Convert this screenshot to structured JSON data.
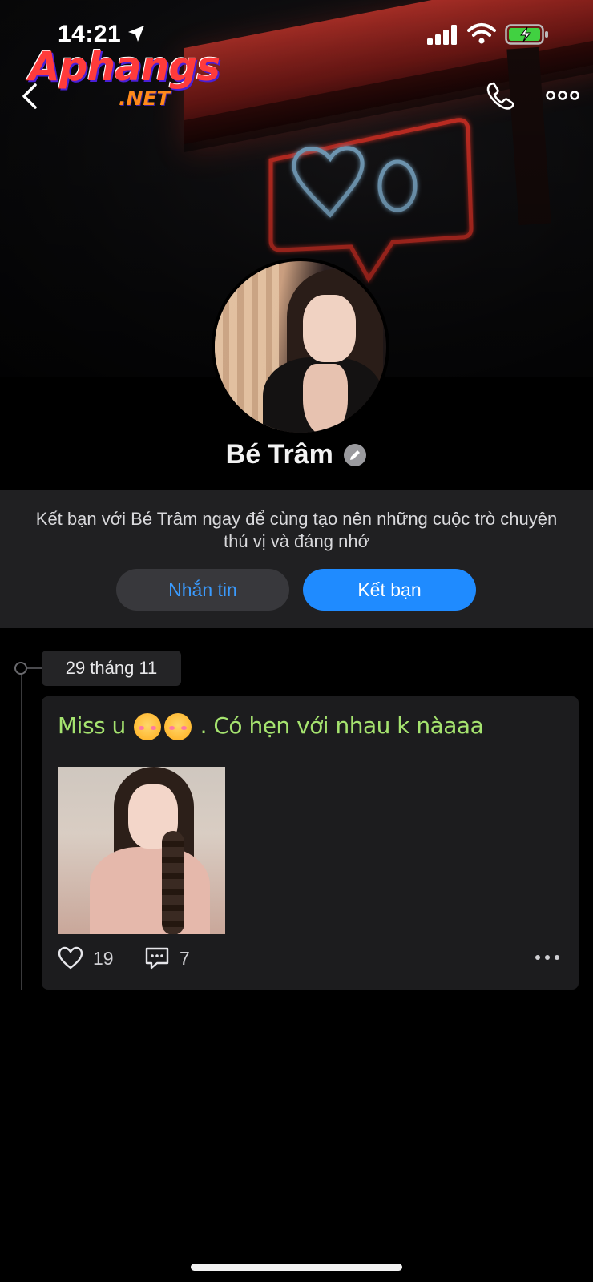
{
  "status_bar": {
    "time": "14:21"
  },
  "watermark": {
    "brand": "Aphangs",
    "suffix": ".NET"
  },
  "profile": {
    "name": "Bé Trâm"
  },
  "friend_panel": {
    "message": "Kết bạn với Bé Trâm ngay để cùng tạo nên những cuộc trò chuyện thú vị và đáng nhớ",
    "message_button": "Nhắn tin",
    "add_friend_button": "Kết bạn"
  },
  "timeline": {
    "date": "29 tháng 11",
    "post": {
      "text_before_emoji": "Miss u",
      "text_after_emoji": ". Có hẹn với nhau k nàaaa",
      "likes": "19",
      "comments": "7"
    }
  },
  "colors": {
    "accent": "#1f8bff",
    "status_text": "#a5e36f",
    "panel_bg": "#202022",
    "card_bg": "#1c1c1e"
  },
  "icons": [
    "location-arrow-icon",
    "signal-icon",
    "wifi-icon",
    "battery-charging-icon",
    "back-chevron-icon",
    "phone-icon",
    "more-dots-icon",
    "verified-edit-icon",
    "heart-icon",
    "comment-icon"
  ]
}
